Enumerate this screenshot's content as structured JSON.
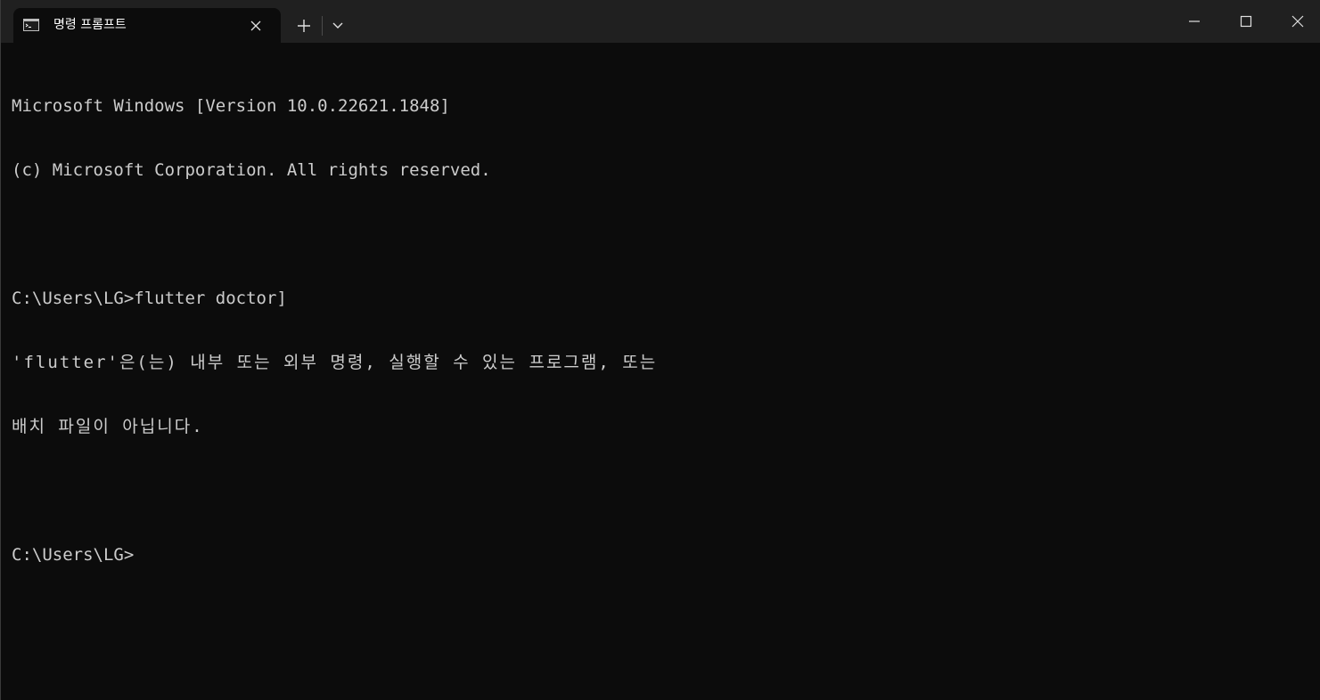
{
  "tab": {
    "title": "명령 프롬프트",
    "icon": "terminal-icon",
    "close_icon": "close-icon"
  },
  "titlebar": {
    "new_tab_icon": "plus-icon",
    "dropdown_icon": "chevron-down-icon",
    "minimize_icon": "minimize-icon",
    "maximize_icon": "maximize-icon",
    "close_icon": "close-icon"
  },
  "terminal": {
    "lines": [
      "Microsoft Windows [Version 10.0.22621.1848]",
      "(c) Microsoft Corporation. All rights reserved.",
      "",
      "C:\\Users\\LG>flutter doctor]",
      "'flutter'은(는) 내부 또는 외부 명령, 실행할 수 있는 프로그램, 또는",
      "배치 파일이 아닙니다.",
      "",
      "C:\\Users\\LG>"
    ]
  },
  "colors": {
    "background": "#0c0c0c",
    "titlebar": "#202020",
    "text": "#cccccc"
  }
}
